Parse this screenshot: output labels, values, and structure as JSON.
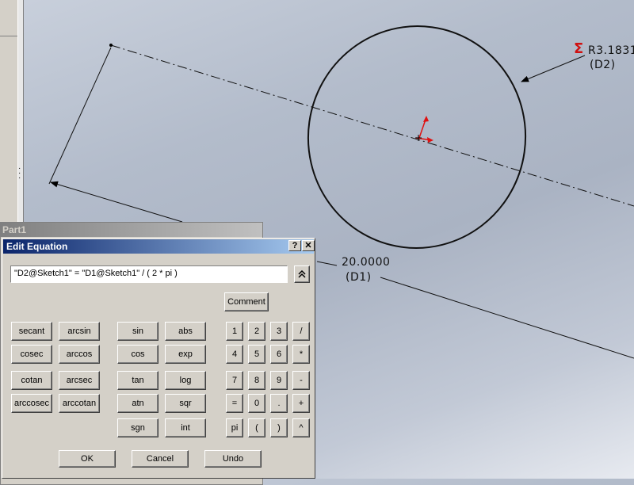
{
  "sketch": {
    "radius_label": "R3.1831",
    "radius_name": "(D2)",
    "length_label": "20.0000",
    "length_name": "(D1)",
    "equation_icon": "sigma-icon",
    "colors": {
      "sketch_line": "#000000",
      "origin": "#e01010",
      "equation_icon": "#d01010"
    }
  },
  "background_window": {
    "title": "Part1"
  },
  "dialog": {
    "title": "Edit Equation",
    "help_label": "?",
    "close_label": "✕",
    "equation_value": "\"D2@Sketch1\" = \"D1@Sketch1\" / ( 2 * pi )",
    "expand_icon": "double-chevron-up-icon",
    "comment_label": "Comment",
    "trig_buttons": [
      "secant",
      "arcsin",
      "cosec",
      "arccos",
      "cotan",
      "arcsec",
      "arccosec",
      "arccotan"
    ],
    "func_buttons": [
      "sin",
      "abs",
      "cos",
      "exp",
      "tan",
      "log",
      "atn",
      "sqr",
      "sgn",
      "int"
    ],
    "keypad": [
      "1",
      "2",
      "3",
      "/",
      "4",
      "5",
      "6",
      "*",
      "7",
      "8",
      "9",
      "-",
      "=",
      "0",
      ".",
      "+",
      "pi",
      "(",
      ")",
      "^"
    ],
    "ok_label": "OK",
    "cancel_label": "Cancel",
    "undo_label": "Undo"
  }
}
